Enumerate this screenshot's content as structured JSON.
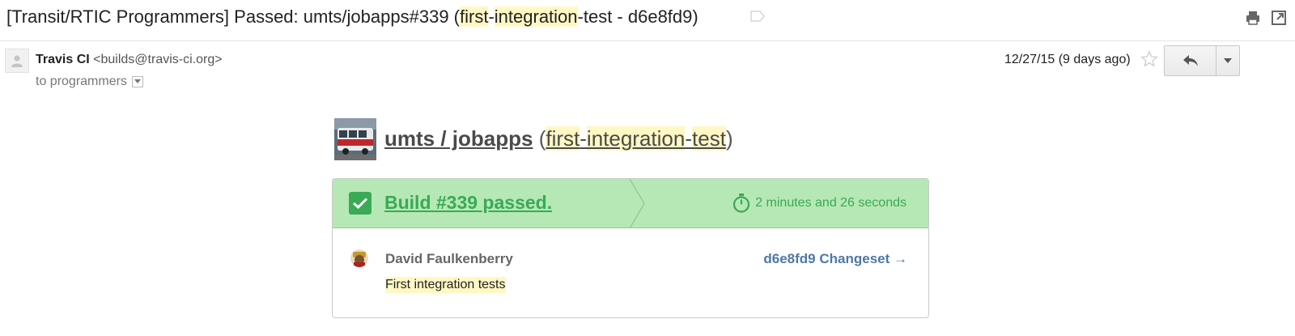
{
  "email": {
    "subject_parts": [
      {
        "text": "[Transit/RTIC Programmers] Passed: umts/jobapps#339 (",
        "hl": false
      },
      {
        "text": "first",
        "hl": true
      },
      {
        "text": "-",
        "hl": false
      },
      {
        "text": "integration",
        "hl": true
      },
      {
        "text": "-test - d6e8fd9)",
        "hl": false
      }
    ],
    "sender_name": "Travis CI",
    "sender_email": "<builds@travis-ci.org>",
    "to_line": "to programmers",
    "date": "12/27/15 (9 days ago)"
  },
  "icons": {
    "label": "label-outline-icon",
    "print": "printer-icon",
    "popout": "new-window-icon",
    "avatar": "person-icon",
    "star": "star-outline-icon",
    "reply": "reply-arrow-icon",
    "more": "caret-down-icon",
    "check": "checkmark-icon",
    "stopwatch": "stopwatch-icon"
  },
  "repo": {
    "name": "umts / jobapps",
    "open_paren": " (",
    "branch_parts": [
      {
        "text": "first",
        "hl": true
      },
      {
        "text": "-",
        "hl": false
      },
      {
        "text": "integration",
        "hl": true
      },
      {
        "text": "-",
        "hl": false
      },
      {
        "text": "test",
        "hl": true
      }
    ],
    "close_paren": ")"
  },
  "build": {
    "title": "Build #339 passed.",
    "duration": "2 minutes and 26 seconds",
    "author": "David Faulkenberry",
    "changeset": "d6e8fd9 Changeset →",
    "commit_message": "First integration tests"
  },
  "colors": {
    "success": "#39aa56",
    "header_bg": "#b6e8b5",
    "link_blue": "#4e78a6",
    "highlight": "#fff8c4"
  }
}
